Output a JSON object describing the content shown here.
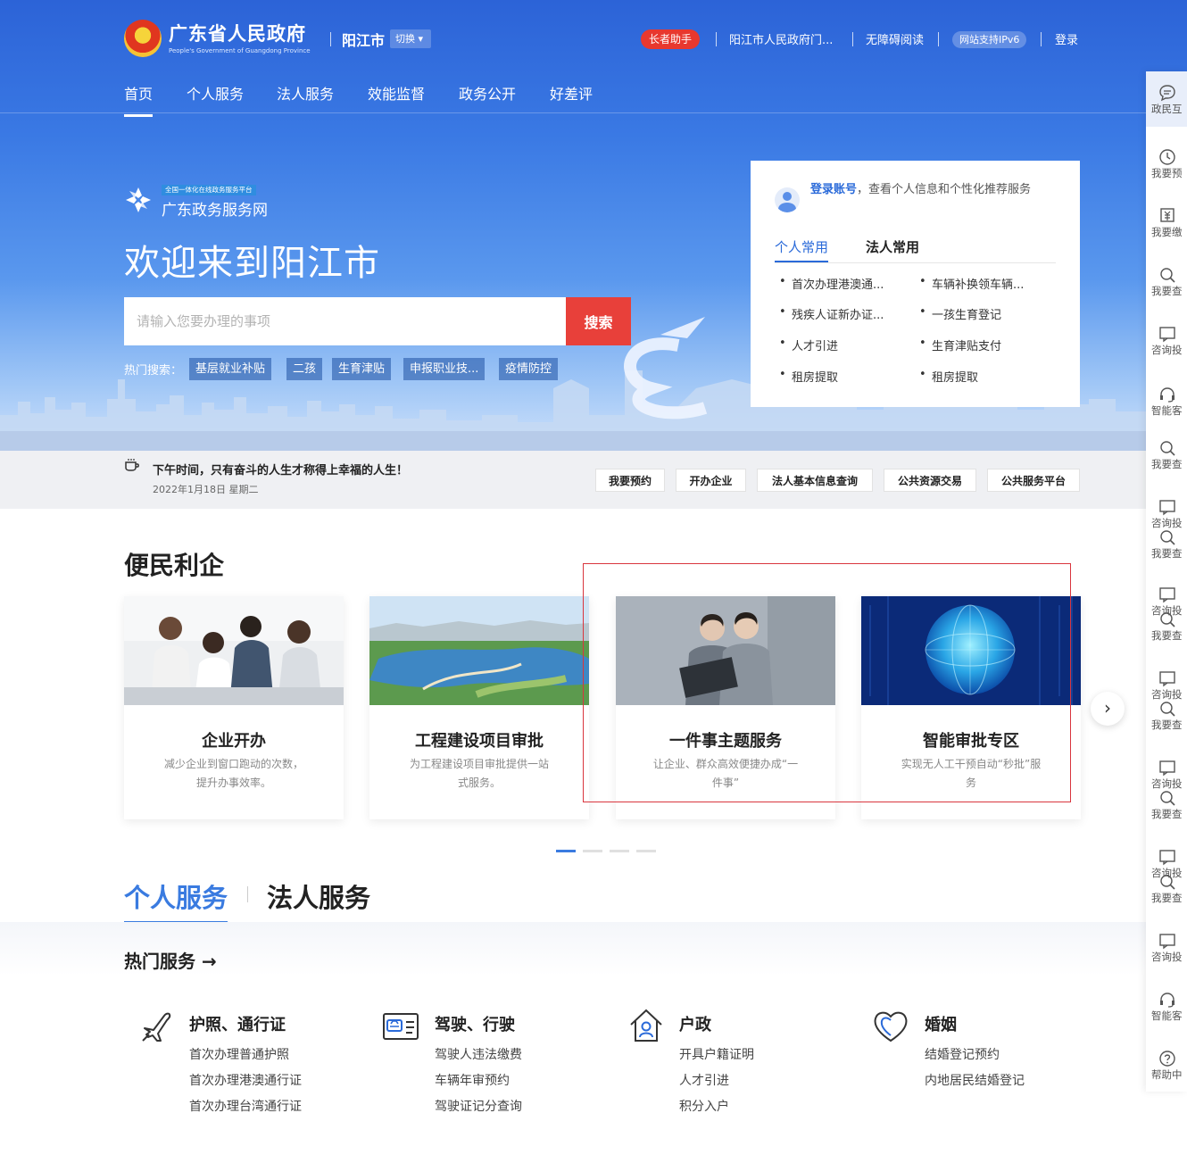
{
  "header": {
    "gov_title": "广东省人民政府",
    "gov_subtitle": "People's Government of Guangdong Province",
    "city": "阳江市",
    "city_switch": "切换",
    "elder_mode": "长者助手",
    "portal_link": "阳江市人民政府门...",
    "accessibility": "无障碍阅读",
    "ipv6": "网站支持IPv6",
    "login": "登录"
  },
  "nav": {
    "items": [
      "首页",
      "个人服务",
      "法人服务",
      "效能监督",
      "政务公开",
      "好差评"
    ]
  },
  "hero": {
    "brand_tag": "全国一体化在线政务服务平台",
    "brand_name": "广东政务服务网",
    "welcome": "欢迎来到阳江市",
    "search_placeholder": "请输入您要办理的事项",
    "search_button": "搜索",
    "hot_label": "热门搜索：",
    "hot_tags": [
      "基层就业补贴",
      "二孩",
      "生育津贴",
      "申报职业技...",
      "疫情防控"
    ]
  },
  "login_card": {
    "link": "登录账号",
    "text": "，查看个人信息和个性化推荐服务",
    "tabs": [
      "个人常用",
      "法人常用"
    ],
    "items": [
      "首次办理港澳通...",
      "车辆补换领车辆...",
      "残疾人证新办证...",
      "一孩生育登记",
      "人才引进",
      "生育津贴支付",
      "租房提取",
      "租房提取"
    ]
  },
  "notice": {
    "title": "下午时间，只有奋斗的人生才称得上幸福的人生！",
    "date": "2022年1月18日 星期二",
    "quick_links": [
      "我要预约",
      "开办企业",
      "法人基本信息查询",
      "公共资源交易",
      "公共服务平台"
    ]
  },
  "convenience": {
    "title": "便民利企",
    "cards": [
      {
        "title": "企业开办",
        "desc": "减少企业到窗口跑动的次数，提升办事效率。"
      },
      {
        "title": "工程建设项目审批",
        "desc": "为工程建设项目审批提供一站式服务。"
      },
      {
        "title": "一件事主题服务",
        "desc": "让企业、群众高效便捷办成“一件事”"
      },
      {
        "title": "智能审批专区",
        "desc": "实现无人工干预自动“秒批”服务"
      }
    ],
    "next_arrow": "›"
  },
  "services": {
    "tabs": [
      "个人服务",
      "法人服务"
    ],
    "hot_title": "热门服务 →",
    "categories": [
      {
        "title": "护照、通行证",
        "icon": "airplane-icon",
        "links": [
          "首次办理普通护照",
          "首次办理港澳通行证",
          "首次办理台湾通行证"
        ]
      },
      {
        "title": "驾驶、行驶",
        "icon": "car-license-icon",
        "links": [
          "驾驶人违法缴费",
          "车辆年审预约",
          "驾驶证记分查询"
        ]
      },
      {
        "title": "户政",
        "icon": "household-icon",
        "links": [
          "开具户籍证明",
          "人才引进",
          "积分入户"
        ]
      },
      {
        "title": "婚姻",
        "icon": "heart-icon",
        "links": [
          "结婚登记预约",
          "内地居民结婚登记"
        ]
      }
    ]
  },
  "float_bar": {
    "items": [
      {
        "label": "政民互",
        "icon": "chat-icon"
      },
      {
        "label": "我要预",
        "icon": "clock-icon"
      },
      {
        "label": "我要缴",
        "icon": "payment-icon"
      },
      {
        "label": "我要查",
        "icon": "search-icon"
      },
      {
        "label": "咨询投",
        "icon": "message-icon"
      },
      {
        "label": "智能客",
        "icon": "headset-icon"
      },
      {
        "label": "我要查",
        "icon": "search-icon"
      },
      {
        "label": "咨询投",
        "icon": "message-icon"
      },
      {
        "label": "我要查",
        "icon": "search-icon"
      },
      {
        "label": "咨询投",
        "icon": "message-icon"
      },
      {
        "label": "我要查",
        "icon": "search-icon"
      },
      {
        "label": "咨询投",
        "icon": "message-icon"
      },
      {
        "label": "我要查",
        "icon": "search-icon"
      },
      {
        "label": "咨询投",
        "icon": "message-icon"
      },
      {
        "label": "我要查",
        "icon": "search-icon"
      },
      {
        "label": "咨询投",
        "icon": "message-icon"
      },
      {
        "label": "我要查",
        "icon": "search-icon"
      },
      {
        "label": "咨询投",
        "icon": "message-icon"
      },
      {
        "label": "智能客",
        "icon": "headset-icon"
      },
      {
        "label": "帮助中",
        "icon": "help-icon"
      }
    ]
  },
  "colors": {
    "primary_blue": "#2a6ad9",
    "accent_red": "#e8403a",
    "highlight_box": "#d9363e"
  }
}
